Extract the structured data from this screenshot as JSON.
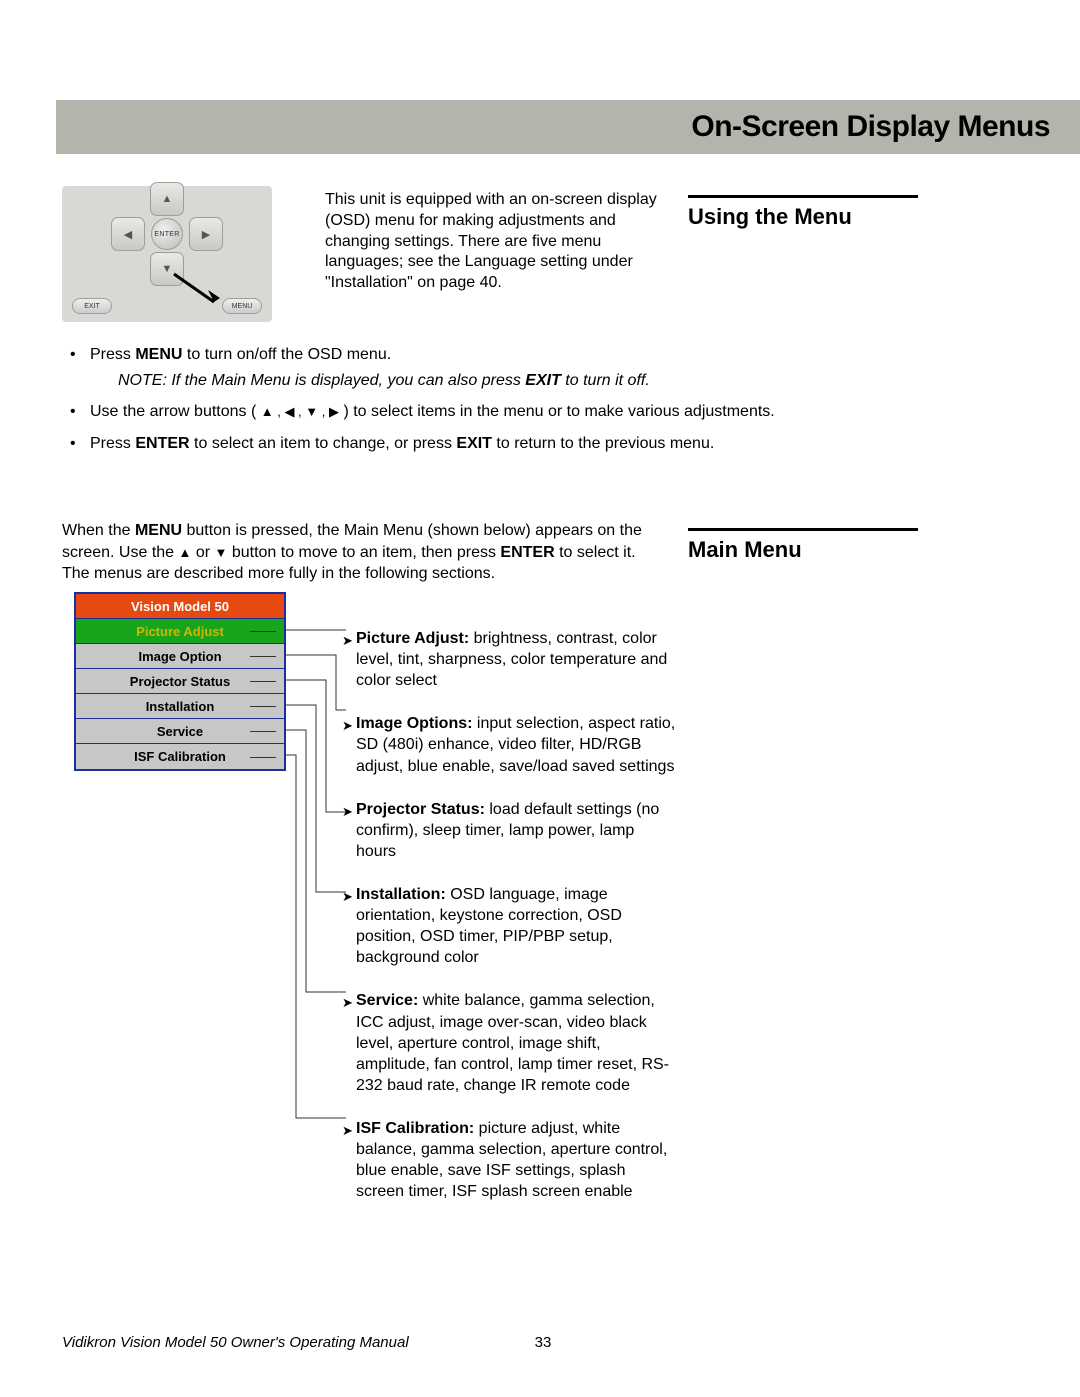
{
  "header": {
    "title": "On-Screen Display Menus"
  },
  "sideHeadings": {
    "using": "Using the Menu",
    "main": "Main Menu"
  },
  "remote": {
    "enter": "ENTER",
    "exit": "EXIT",
    "menu": "MENU",
    "up": "▲",
    "down": "▼",
    "left": "◀",
    "right": "▶"
  },
  "intro": "This unit is equipped with an on-screen display (OSD) menu for making adjustments and changing settings. There are five menu languages; see the Language setting under \"Installation\" on page 40.",
  "bullets": {
    "b1_pre": "Press ",
    "b1_bold": "MENU",
    "b1_post": " to turn on/off the OSD menu.",
    "note_pre": "NOTE: If the Main Menu is displayed, you can also press ",
    "note_bold": "EXIT",
    "note_post": " to turn it off.",
    "b2_pre": "Use the arrow buttons ( ",
    "b2_arrows": "▲ , ◀ , ▼ , ▶",
    "b2_post": " ) to select items in the menu or to make various adjustments.",
    "b3_pre": "Press ",
    "b3_b1": "ENTER",
    "b3_mid": " to select an item to change, or press ",
    "b3_b2": "EXIT",
    "b3_post": " to return to the previous menu."
  },
  "para2": {
    "p1": "When the ",
    "p1b": "MENU",
    "p2": " button is pressed, the Main Menu (shown below) appears on the screen. Use the ",
    "p3": "▲",
    "p4": " or ",
    "p5": "▼",
    "p6": " button to move to an item, then press ",
    "p6b": "ENTER",
    "p7": " to select it. The menus are described more fully in the following sections."
  },
  "menu": {
    "title": "Vision Model 50",
    "items": [
      "Picture Adjust",
      "Image Option",
      "Projector Status",
      "Installation",
      "Service",
      "ISF Calibration"
    ]
  },
  "descriptions": [
    {
      "label": "Picture Adjust:",
      "text": " brightness, contrast, color level, tint, sharpness, color temperature and color select"
    },
    {
      "label": "Image Options:",
      "text": " input selection, aspect ratio, SD (480i) enhance, video filter, HD/RGB adjust, blue enable, save/load saved settings"
    },
    {
      "label": "Projector Status:",
      "text": " load default settings (no confirm), sleep timer, lamp power, lamp hours"
    },
    {
      "label": "Installation:",
      "text": " OSD language, image orientation, keystone correction, OSD position, OSD timer, PIP/PBP setup, background color"
    },
    {
      "label": "Service:",
      "text": " white balance, gamma selection, ICC adjust, image over-scan, video black level, aperture control, image shift, amplitude, fan control, lamp timer reset, RS-232 baud rate, change IR remote code"
    },
    {
      "label": "ISF Calibration:",
      "text": " picture adjust, white balance, gamma selection, aperture control, blue enable, save ISF settings, splash screen timer, ISF splash screen enable"
    }
  ],
  "footer": {
    "title": "Vidikron Vision Model 50 Owner's Operating Manual",
    "page": "33"
  }
}
